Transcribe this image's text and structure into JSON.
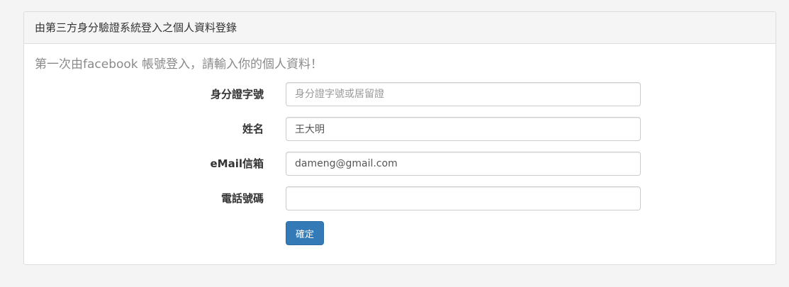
{
  "panel": {
    "title": "由第三方身分驗證系統登入之個人資料登錄"
  },
  "intro_text": "第一次由facebook 帳號登入，請輸入你的個人資料！",
  "form": {
    "fields": [
      {
        "label": "身分證字號",
        "value": "",
        "placeholder": "身分證字號或居留證"
      },
      {
        "label": "姓名",
        "value": "王大明",
        "placeholder": ""
      },
      {
        "label": "eMail信箱",
        "value": "dameng@gmail.com",
        "placeholder": ""
      },
      {
        "label": "電話號碼",
        "value": "",
        "placeholder": ""
      }
    ],
    "submit_label": "確定"
  },
  "colors": {
    "primary_button": "#337ab7",
    "panel_heading_bg": "#f5f5f5",
    "intro_text": "#8a8a8a"
  }
}
